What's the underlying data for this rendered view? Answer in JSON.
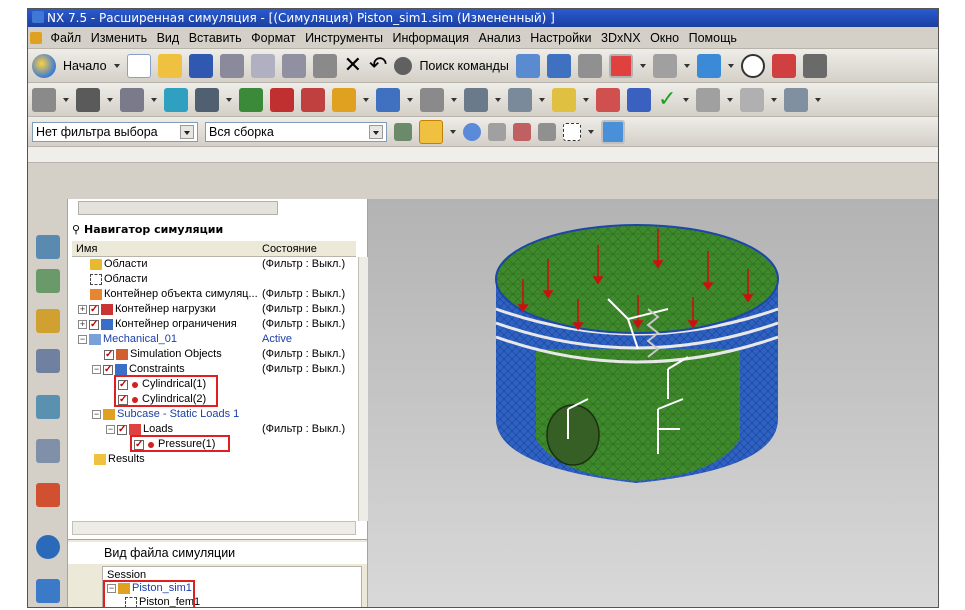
{
  "window": {
    "title": "NX 7.5 - Расширенная симуляция - [(Симуляция) Piston_sim1.sim (Измененный) ]"
  },
  "menu": {
    "items": [
      "Файл",
      "Изменить",
      "Вид",
      "Вставить",
      "Формат",
      "Инструменты",
      "Информация",
      "Анализ",
      "Настройки",
      "3DxNX",
      "Окно",
      "Помощь"
    ]
  },
  "toolbar1": {
    "start_label": "Начало",
    "command_search_label": "Поиск команды"
  },
  "selection_bar": {
    "filter_value": "Нет фильтра выбора",
    "scope_value": "Вся сборка"
  },
  "navigator": {
    "title": "Навигатор симуляции",
    "col_name": "Имя",
    "col_state": "Состояние",
    "rows": [
      {
        "label": "Области",
        "state": "(Фильтр : Выкл.)"
      },
      {
        "label": "Области",
        "state": ""
      },
      {
        "label": "Контейнер объекта симуляц...",
        "state": "(Фильтр : Выкл.)"
      },
      {
        "label": "Контейнер нагрузки",
        "state": "(Фильтр : Выкл.)"
      },
      {
        "label": "Контейнер ограничения",
        "state": "(Фильтр : Выкл.)"
      },
      {
        "label": "Mechanical_01",
        "state": "Active"
      },
      {
        "label": "Simulation Objects",
        "state": "(Фильтр : Выкл.)"
      },
      {
        "label": "Constraints",
        "state": "(Фильтр : Выкл.)"
      },
      {
        "label": "Cylindrical(1)",
        "state": ""
      },
      {
        "label": "Cylindrical(2)",
        "state": ""
      },
      {
        "label": "Subcase - Static Loads 1",
        "state": ""
      },
      {
        "label": "Loads",
        "state": "(Фильтр : Выкл.)"
      },
      {
        "label": "Pressure(1)",
        "state": ""
      },
      {
        "label": "Results",
        "state": ""
      }
    ]
  },
  "file_view": {
    "title": "Вид файла симуляции",
    "session_label": "Session",
    "sim_file": "Piston_sim1",
    "fem_file": "Piston_fem1"
  },
  "colors": {
    "title_bar": "#1a3fa0",
    "mesh_green": "#3a8a2a",
    "mesh_blue": "#2a5fc0",
    "highlight_red": "#e02020",
    "viewport_bg": "#c4c4c4"
  }
}
